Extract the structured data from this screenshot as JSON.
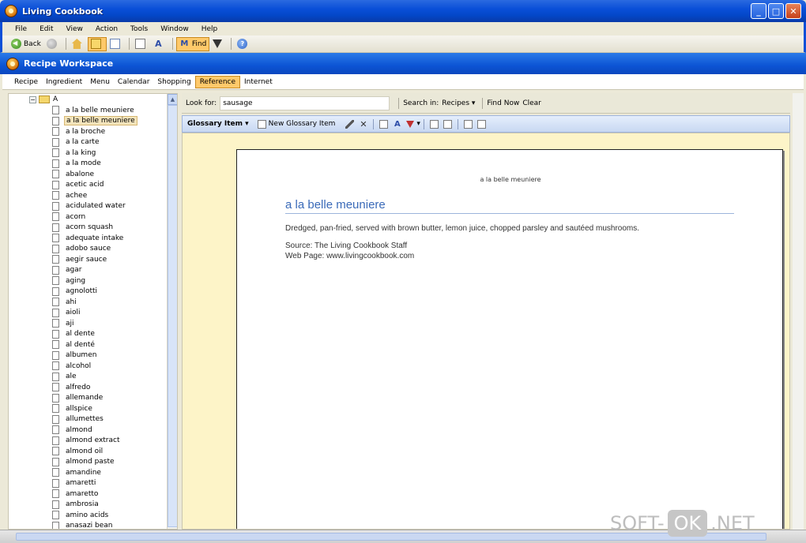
{
  "window": {
    "title": "Living Cookbook",
    "buttons": [
      "_",
      "□",
      "✕"
    ]
  },
  "menu": [
    "File",
    "Edit",
    "View",
    "Action",
    "Tools",
    "Window",
    "Help"
  ],
  "toolbar": {
    "back_label": "Back",
    "find_label": "Find"
  },
  "workspace": {
    "title": "Recipe Workspace",
    "nav": [
      "Recipe",
      "Ingredient",
      "Menu",
      "Calendar",
      "Shopping",
      "Reference",
      "Internet"
    ],
    "active_nav": "Reference"
  },
  "tree": {
    "root": "A",
    "items": [
      "a la belle meuniere",
      "a la belle meuniere",
      "a la broche",
      "a la carte",
      "a la king",
      "a la mode",
      "abalone",
      "acetic acid",
      "achee",
      "acidulated water",
      "acorn",
      "acorn squash",
      "adequate intake",
      "adobo sauce",
      "aegir sauce",
      "agar",
      "aging",
      "agnolotti",
      "ahi",
      "aioli",
      "aji",
      "al dente",
      "al denté",
      "albumen",
      "alcohol",
      "ale",
      "alfredo",
      "allemande",
      "allspice",
      "allumettes",
      "almond",
      "almond extract",
      "almond oil",
      "almond paste",
      "amandine",
      "amaretti",
      "amaretto",
      "ambrosia",
      "amino acids",
      "anasazi bean"
    ],
    "selected_index": 1
  },
  "search": {
    "look_for_label": "Look for:",
    "look_for_value": "sausage",
    "search_in_label": "Search in:",
    "search_in_value": "Recipes",
    "find_now": "Find Now",
    "clear": "Clear"
  },
  "glossary_toolbar": {
    "title": "Glossary Item",
    "new_label": "New Glossary Item"
  },
  "page": {
    "header": "a la belle meuniere",
    "title": "a la belle meuniere",
    "description": "Dredged, pan-fried, served with brown butter, lemon juice, chopped parsley and sautéed mushrooms.",
    "source": "Source: The Living Cookbook Staff",
    "web_page": "Web Page: www.livingcookbook.com"
  },
  "watermark": {
    "left": "SOFT-",
    "mid": "OK",
    "right": ".NET"
  },
  "colors": {
    "title_bar": "#0a4fd8",
    "active_tab": "#ffc96a",
    "page_title": "#3a6ab8",
    "content_bg": "#fdf4c8"
  }
}
